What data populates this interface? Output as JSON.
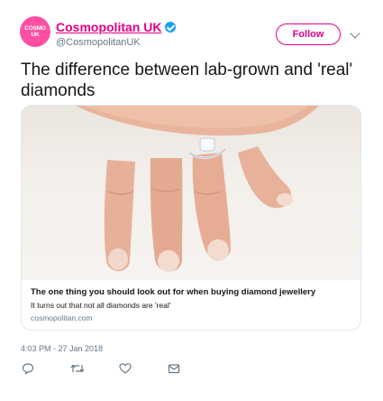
{
  "account": {
    "avatar_text": "COSMO UK",
    "name": "Cosmopolitan UK",
    "handle": "@CosmopolitanUK",
    "verified": true
  },
  "follow_label": "Follow",
  "tweet_text": "The difference between lab-grown and 'real' diamonds",
  "card": {
    "title": "The one thing you should look out for when buying diamond jewellery",
    "description": "It turns out that not all diamonds are 'real'",
    "domain": "cosmopolitan.com"
  },
  "timestamp": "4:03 PM - 27 Jan 2018",
  "actions": {
    "reply": "reply-icon",
    "retweet": "retweet-icon",
    "like": "heart-icon",
    "message": "envelope-icon"
  },
  "colors": {
    "brand": "#e20088",
    "verified": "#1da1f2",
    "secondary_text": "#657786"
  }
}
